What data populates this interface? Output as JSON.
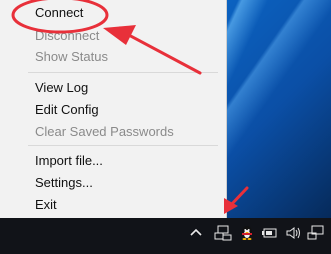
{
  "menu": {
    "items": [
      {
        "label": "Connect",
        "enabled": true
      },
      {
        "label": "Disconnect",
        "enabled": false
      },
      {
        "label": "Show Status",
        "enabled": false
      },
      {
        "label": "View Log",
        "enabled": true
      },
      {
        "label": "Edit Config",
        "enabled": true
      },
      {
        "label": "Clear Saved Passwords",
        "enabled": false
      },
      {
        "label": "Import file...",
        "enabled": true
      },
      {
        "label": "Settings...",
        "enabled": true
      },
      {
        "label": "Exit",
        "enabled": true
      }
    ]
  },
  "annotations": {
    "color": "#e8303a",
    "circle_target": "Connect",
    "arrows": 2
  },
  "taskbar": {
    "icons": [
      "chevron-up-icon",
      "network-icon",
      "penguin-icon",
      "battery-icon",
      "volume-icon",
      "wired-network-icon"
    ]
  }
}
